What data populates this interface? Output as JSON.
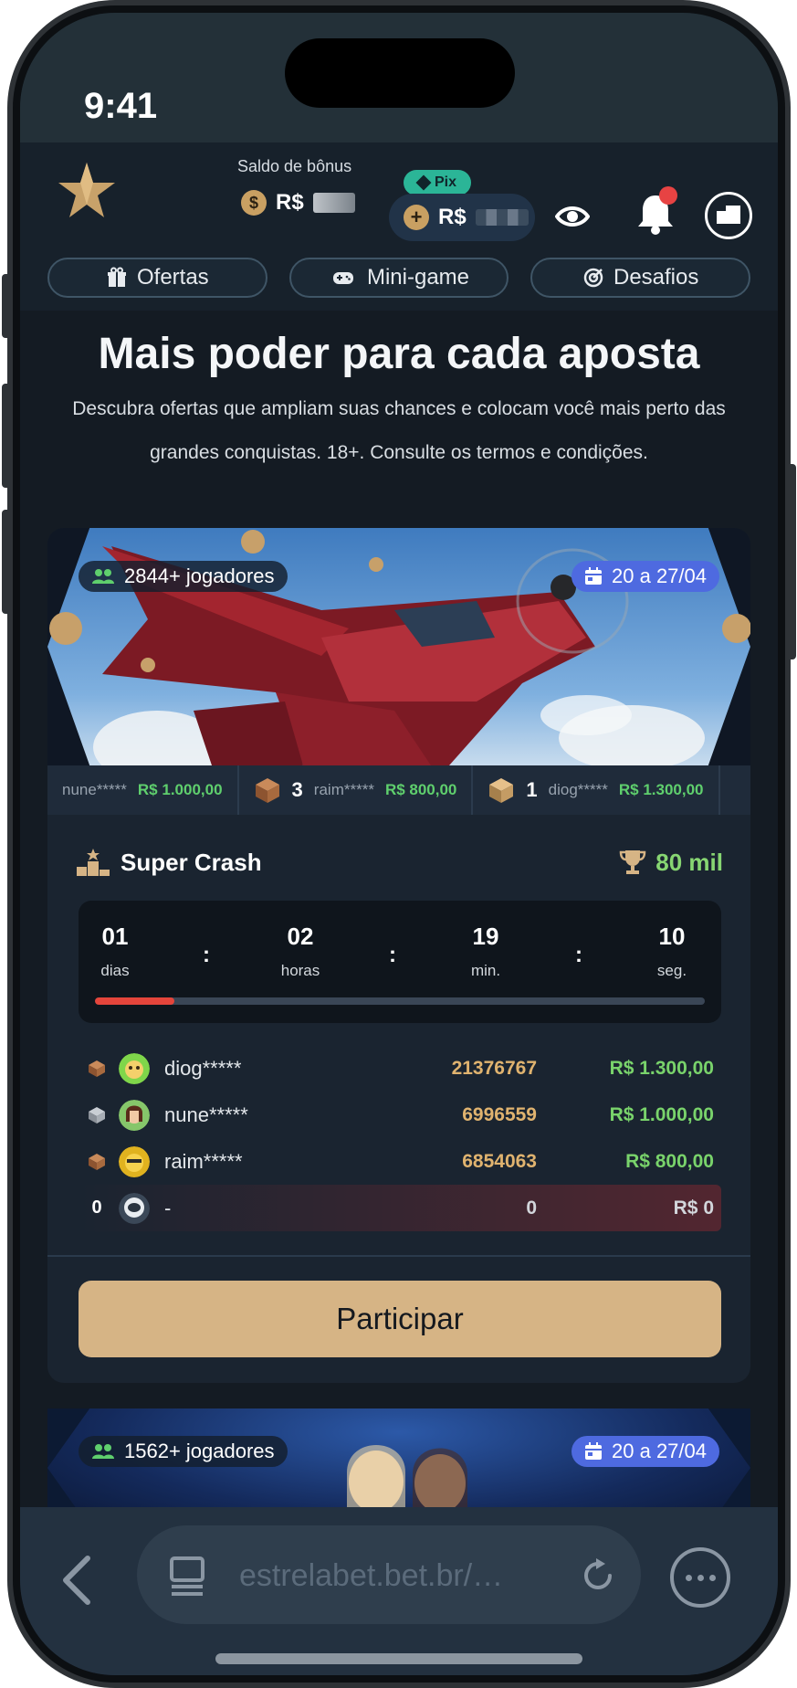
{
  "status_bar": {
    "time": "9:41"
  },
  "header": {
    "bonus_label": "Saldo de bônus",
    "bonus_currency": "R$",
    "pix_label": "Pix",
    "balance_currency": "R$"
  },
  "nav": {
    "tabs": [
      {
        "label": "Ofertas",
        "icon": "gift-icon"
      },
      {
        "label": "Mini-game",
        "icon": "gamepad-icon"
      },
      {
        "label": "Desafios",
        "icon": "target-icon"
      }
    ]
  },
  "main": {
    "title": "Mais poder para cada aposta",
    "description": "Descubra ofertas que ampliam suas chances e colocam você mais perto das grandes conquistas. 18+. Consulte os termos e condições."
  },
  "tournament": {
    "players": "2844+ jogadores",
    "dates": "20 a 27/04",
    "ticker": [
      {
        "rank": "",
        "name": "nune*****",
        "amount": "R$ 1.000,00"
      },
      {
        "rank": "3",
        "name": "raim*****",
        "amount": "R$ 800,00"
      },
      {
        "rank": "1",
        "name": "diog*****",
        "amount": "R$ 1.300,00"
      }
    ],
    "title": "Super Crash",
    "prize": "80 mil",
    "countdown": {
      "days": "01",
      "days_label": "dias",
      "hours": "02",
      "hours_label": "horas",
      "minutes": "19",
      "minutes_label": "min.",
      "seconds": "10",
      "seconds_label": "seg.",
      "separator": ":",
      "progress_fraction": 0.13
    },
    "leaderboard": [
      {
        "position": "",
        "name": "diog*****",
        "score": "21376767",
        "prize": "R$ 1.300,00"
      },
      {
        "position": "",
        "name": "nune*****",
        "score": "6996559",
        "prize": "R$ 1.000,00"
      },
      {
        "position": "",
        "name": "raim*****",
        "score": "6854063",
        "prize": "R$ 800,00"
      },
      {
        "position": "0",
        "name": "-",
        "score": "0",
        "prize": "R$ 0"
      }
    ],
    "join_label": "Participar"
  },
  "tournament2": {
    "players": "1562+ jogadores",
    "dates": "20 a 27/04"
  },
  "browser": {
    "url": "estrelabet.bet.br/…"
  },
  "colors": {
    "accent_gold": "#d6b485",
    "prize_green": "#79d36b",
    "score_gold": "#e0b36f",
    "progress_red": "#e5453b",
    "pix_teal": "#2bb597",
    "date_blue": "#4e6ae0"
  }
}
